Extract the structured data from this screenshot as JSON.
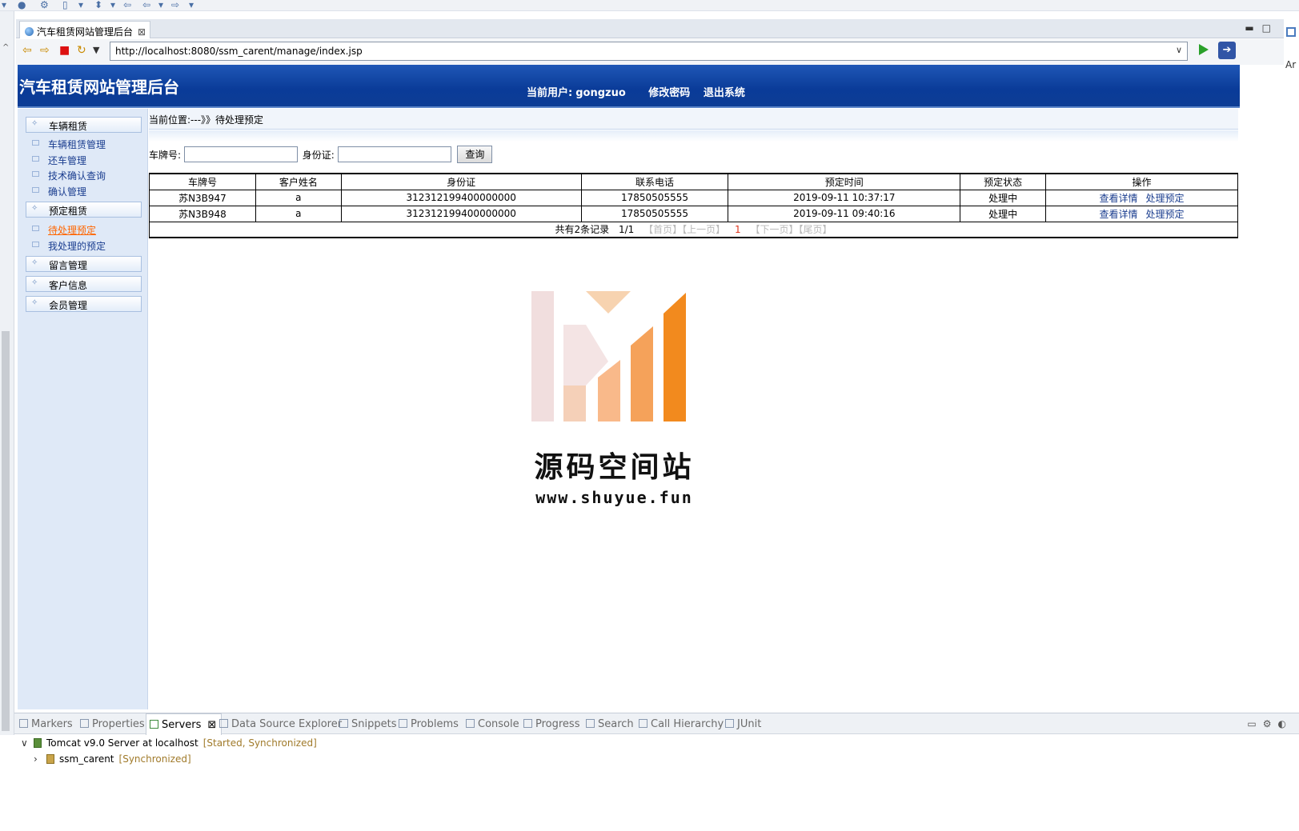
{
  "browser": {
    "tab_title": "汽车租赁网站管理后台",
    "url": "http://localhost:8080/ssm_carent/manage/index.jsp"
  },
  "header": {
    "site_title": "汽车租赁网站管理后台",
    "current_user_label": "当前用户:",
    "username": "gongzuo",
    "change_password": "修改密码",
    "logout": "退出系统"
  },
  "sidebar": {
    "groups": [
      {
        "label": "车辆租赁",
        "items": [
          "车辆租赁管理",
          "还车管理",
          "技术确认查询",
          "确认管理"
        ]
      },
      {
        "label": "预定租赁",
        "items": [
          "待处理预定",
          "我处理的预定"
        ]
      },
      {
        "label": "留言管理",
        "items": []
      },
      {
        "label": "客户信息",
        "items": []
      },
      {
        "label": "会员管理",
        "items": []
      }
    ],
    "active_item": "待处理预定"
  },
  "breadcrumb": "当前位置:---》》待处理预定",
  "search": {
    "plate_label": "车牌号:",
    "plate_value": "",
    "id_label": "身份证:",
    "id_value": "",
    "button": "查询"
  },
  "table": {
    "columns": [
      "车牌号",
      "客户姓名",
      "身份证",
      "联系电话",
      "预定时间",
      "预定状态",
      "操作"
    ],
    "rows": [
      {
        "plate": "苏N3B947",
        "name": "a",
        "id": "312312199400000000",
        "phone": "17850505555",
        "time": "2019-09-11 10:37:17",
        "status": "处理中",
        "op_view": "查看详情",
        "op_handle": "处理预定"
      },
      {
        "plate": "苏N3B948",
        "name": "a",
        "id": "312312199400000000",
        "phone": "17850505555",
        "time": "2019-09-11 09:40:16",
        "status": "处理中",
        "op_view": "查看详情",
        "op_handle": "处理预定"
      }
    ],
    "pager": {
      "total": "共有2条记录",
      "page_info": "1/1",
      "first": "【首页】",
      "prev": "【上一页】",
      "current": "1",
      "next": "【下一页】",
      "last": "【尾页】"
    }
  },
  "watermark": {
    "name": "源码空间站",
    "url": "www.shuyue.fun"
  },
  "bottom_panel": {
    "tabs": [
      "Markers",
      "Properties",
      "Servers",
      "Data Source Explorer",
      "Snippets",
      "Problems",
      "Console",
      "Progress",
      "Search",
      "Call Hierarchy",
      "JUnit"
    ],
    "active_tab": "Servers",
    "server": {
      "name": "Tomcat v9.0 Server at localhost",
      "state": "[Started, Synchronized]"
    },
    "module": {
      "name": "ssm_carent",
      "state": "[Synchronized]"
    }
  },
  "right_strip_text": "Ar"
}
